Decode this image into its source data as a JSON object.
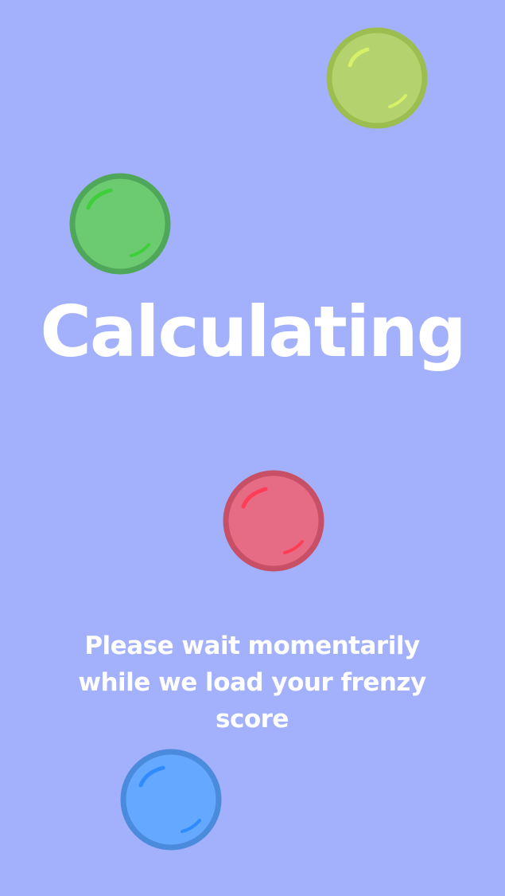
{
  "screen": {
    "background_color": "#a3b1fd",
    "title": "Calculating",
    "message": "Please wait momentarily while we load your frenzy score"
  },
  "balls": [
    {
      "name": "lime",
      "fill": "#b4d36e",
      "stroke": "#9cbd4f",
      "highlight": "#d6f06a"
    },
    {
      "name": "green",
      "fill": "#6ccb70",
      "stroke": "#4fa75a",
      "highlight": "#3ecf3a"
    },
    {
      "name": "red",
      "fill": "#e66c85",
      "stroke": "#c74f66",
      "highlight": "#ff3d56"
    },
    {
      "name": "blue",
      "fill": "#65a8ff",
      "stroke": "#4a8bdd",
      "highlight": "#2f8bff"
    }
  ]
}
